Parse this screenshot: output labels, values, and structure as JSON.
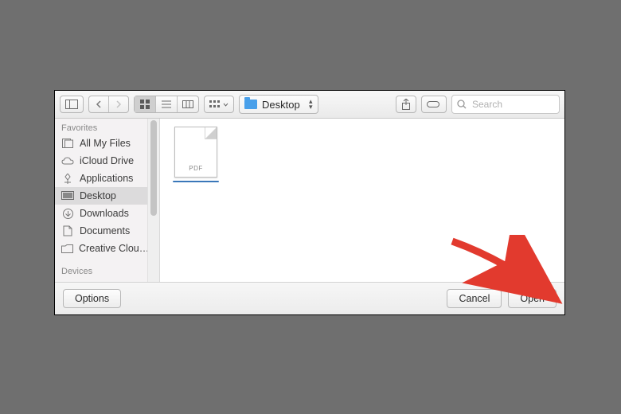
{
  "toolbar": {
    "path_label": "Desktop",
    "search_placeholder": "Search"
  },
  "sidebar": {
    "sections": {
      "favorites": "Favorites",
      "devices": "Devices"
    },
    "items": [
      {
        "label": "All My Files"
      },
      {
        "label": "iCloud Drive"
      },
      {
        "label": "Applications"
      },
      {
        "label": "Desktop"
      },
      {
        "label": "Downloads"
      },
      {
        "label": "Documents"
      },
      {
        "label": "Creative Clou…"
      }
    ]
  },
  "content": {
    "file_tag": "PDF"
  },
  "footer": {
    "options": "Options",
    "cancel": "Cancel",
    "open": "Open"
  }
}
